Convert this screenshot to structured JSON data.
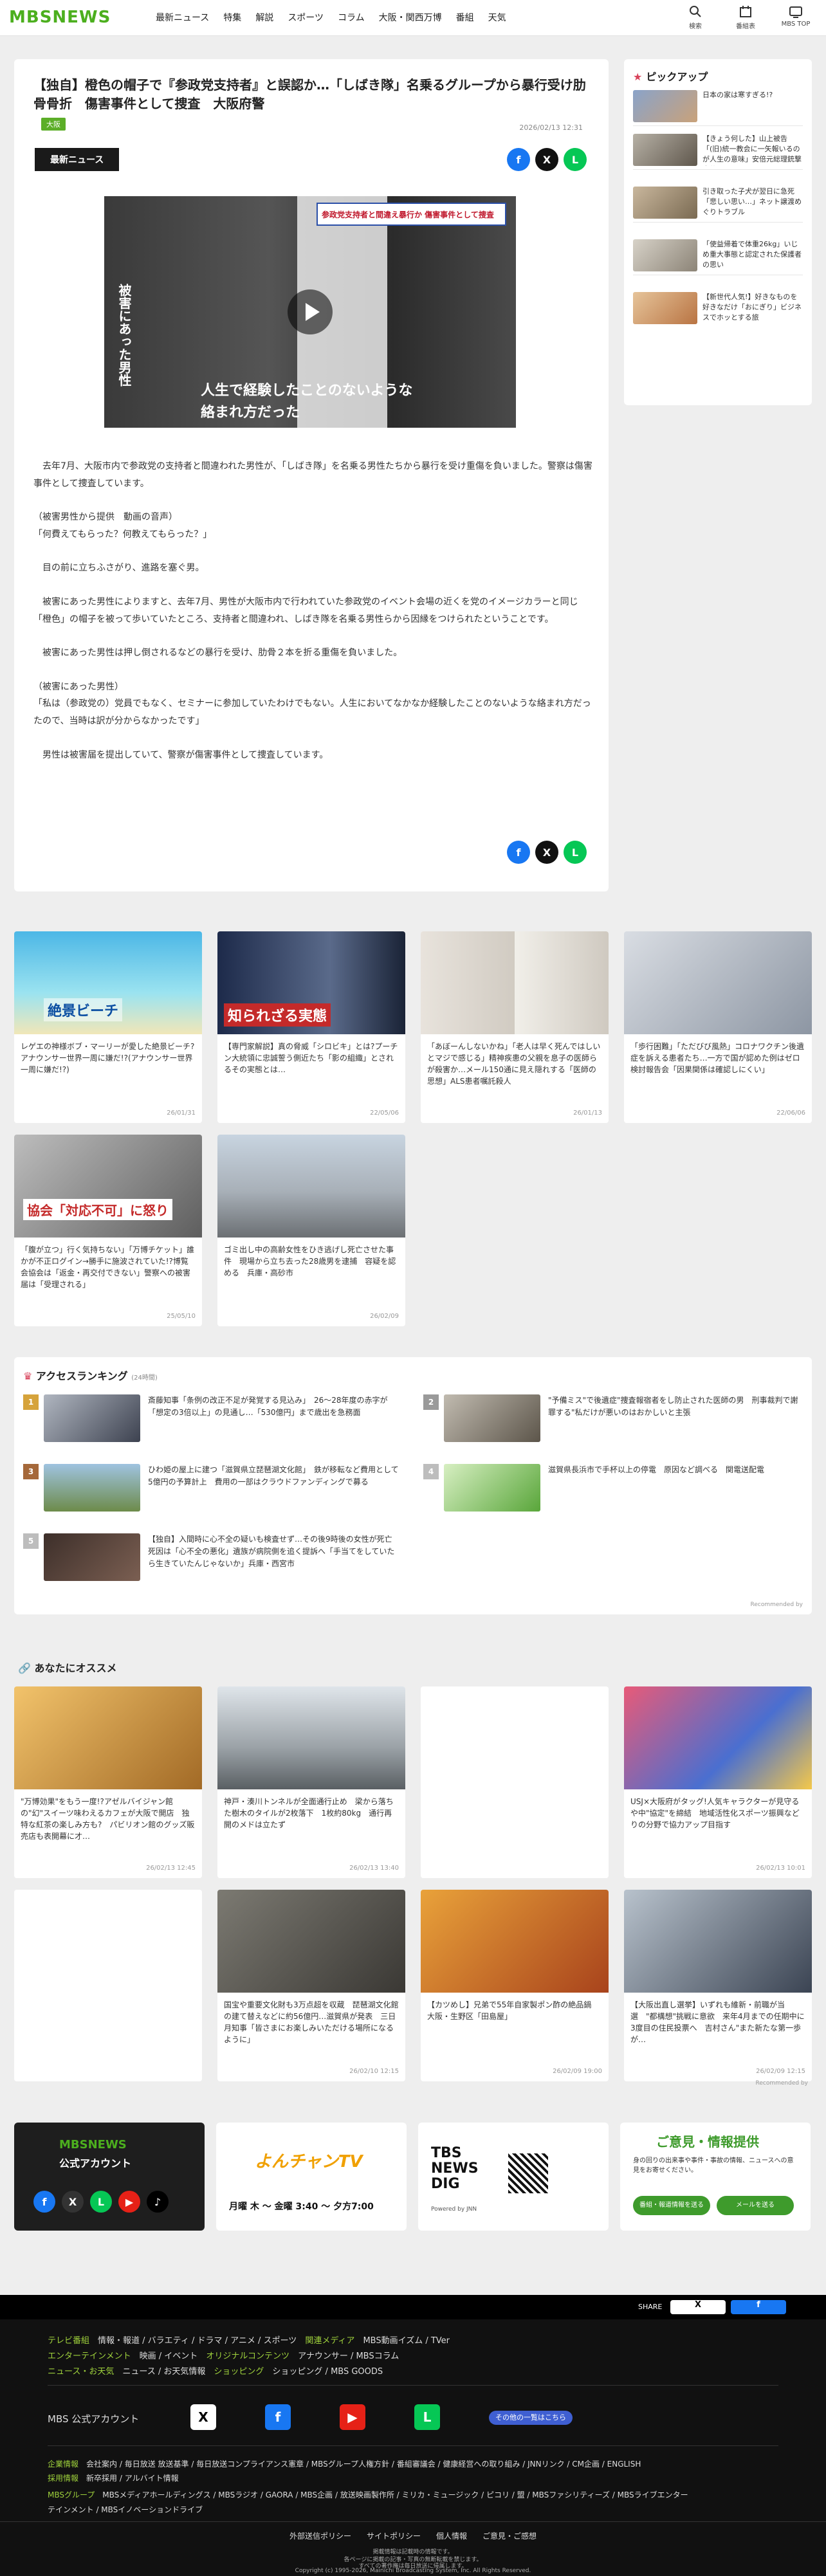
{
  "header": {
    "logo": "MBSNEWS",
    "nav": [
      "最新ニュース",
      "特集",
      "解説",
      "スポーツ",
      "コラム",
      "大阪・関西万博",
      "番組",
      "天気"
    ],
    "icons": [
      {
        "label": "検索",
        "icon": "search-icon"
      },
      {
        "label": "番組表",
        "icon": "calendar-icon"
      },
      {
        "label": "MBS TOP",
        "icon": "tv-icon"
      }
    ]
  },
  "article": {
    "title": "【独自】橙色の帽子で『参政党支持者』と誤認か…「しばき隊」名乗るグループから暴行受け肋骨骨折　傷害事件として捜査　大阪府警",
    "tag": "大阪",
    "date": "2026/02/13 12:31",
    "category": "最新ニュース",
    "video": {
      "top_caption": "参政党支持者と間違え暴行か 傷害事件として捜査",
      "side_caption": "被害にあった男性",
      "subtitle_line1": "人生で経験したことのないような",
      "subtitle_line2": "絡まれ方だった"
    },
    "paragraphs": [
      "　去年7月、大阪市内で参政党の支持者と間違われた男性が、「しばき隊」を名乗る男性たちから暴行を受け重傷を負いました。警察は傷害事件として捜査しています。",
      "（被害男性から提供　動画の音声）\n「何費えてもらった？何教えてもらった？」",
      "　目の前に立ちふさがり、進路を塞ぐ男。",
      "　被害にあった男性によりますと、去年7月、男性が大阪市内で行われていた参政党のイベント会場の近くを党のイメージカラーと同じ「橙色」の帽子を被って歩いていたところ、支持者と間違われ、しばき隊を名乗る男性らから因縁をつけられたということです。",
      "　被害にあった男性は押し倒されるなどの暴行を受け、肋骨２本を折る重傷を負いました。",
      "（被害にあった男性）\n「私は（参政党の）党員でもなく、セミナーに参加していたわけでもない。人生においてなかなか経験したことのないような絡まれ方だったので、当時は訳が分からなかったです」",
      "　男性は被害届を提出していて、警察が傷害事件として捜査しています。"
    ]
  },
  "pickup": {
    "title": "ピックアップ",
    "items": [
      "日本の家は寒すぎる!?",
      "【きょう何した】山上被告「(旧)統一教会に一矢報いるのが人生の意味」安倍元総理銃撃事件",
      "引き取った子犬が翌日に急死「悲しい思い…」ネット譲渡めぐりトラブル",
      "「使益帰着で体重26kg」いじめ重大事態と認定された保護者の思い",
      "【新世代人気!】好きなものを好きなだけ「おにぎり」ビジネスでホッとする旅"
    ]
  },
  "related": [
    {
      "text": "レゲエの神様ボブ・マーリーが愛した絶景ビーチ?アナウンサー世界一周に嫌だ!?(アナウンサー世界一周に嫌だ!?)",
      "date": "26/01/31",
      "label": "絶景ビーチ"
    },
    {
      "text": "【専門家解説】真の脅威「シロビキ」とは?プーチン大統領に忠誠誓う側近たち「影の組織」とされるその実態とは…",
      "date": "22/05/06",
      "label": "知られざる実態"
    },
    {
      "text": "「あぼーんしないかね」「老人は早く死んではしいとマジで感じる」精神疾患の父親を息子の医師らが殺害か…メール150通に見え隠れする「医師の思想」ALS患者嘱託殺人",
      "date": "26/01/13",
      "label": ""
    },
    {
      "text": "「歩行困難」「ただびび風熱」コロナワクチン後遺症を訴える患者たち…一方で国が認めた例はゼロ　検討報告会「因果関係は確認しにくい」",
      "date": "22/06/06",
      "label": ""
    },
    {
      "text": "「腹が立つ」行く気持ちない」「万博チケット」誰かが不正ログイン→勝手に施波されていた!?博覧会協会は「返金・再交付できない」警察への被害届は「受理される」",
      "date": "25/05/10",
      "label": "協会「対応不可」に怒り"
    },
    {
      "text": "ゴミ出し中の高齢女性をひき逃げし死亡させた事件　現場から立ち去った28歳男を逮捕　容疑を認める　兵庫・高砂市",
      "date": "26/02/09",
      "label": ""
    }
  ],
  "ranking": {
    "title": "アクセスランキング",
    "period": "(24時間)",
    "items": [
      {
        "rank": "1",
        "text": "斎藤知事「条例の改正不足が発覚する見込み」　26〜28年度の赤字が「想定の3倍以上」の見通し…「530億円」まで歳出を急務面"
      },
      {
        "rank": "2",
        "text": "\"予備ミス\"で後遺症\"捜査報宿者をし防止された医師の男　刑事裁判で謝罪する\"私だけが悪いのはおかしいと主張"
      },
      {
        "rank": "3",
        "text": "ひわ姫の屋上に建つ「滋賀県立琵琶湖文化館」　鉄が移転など費用として5億円の予算計上　費用の一部はクラウドファンディングで募る"
      },
      {
        "rank": "4",
        "text": "滋賀県長浜市で手杯以上の停電　原因など調べる　関電送配電"
      },
      {
        "rank": "5",
        "text": "【独自】入間時に心不全の疑いも検査せず…その後9時後の女性が死亡　死因は「心不全の悪化」遺族が病院側を追く提訴へ「手当てをしていたら生きていたんじゃないか」兵庫・西宮市"
      }
    ],
    "note": "Recommended by"
  },
  "recommend": {
    "title": "あなたにオススメ",
    "items": [
      {
        "text": "\"万博効果\"をもう一度!?アゼルバイジャン館の\"幻\"スイーツ味わえるカフェが大阪で開店　独特な紅茶の楽しみ方も?　パビリオン館のグッズ販売店も表開幕に才…",
        "date": "26/02/13 12:45"
      },
      {
        "text": "神戸・湊川トンネルが全面通行止め　梁から落ちた樹木のタイルが2枚落下　1枚約80kg　通行再開のメドは立たず",
        "date": "26/02/13 13:40"
      },
      {
        "text": "",
        "date": ""
      },
      {
        "text": "USJ×大阪府がタッグ!人気キャラクターが見守るや中\"協定\"を締結　地域活性化スポーツ振興などりの分野で協力アップ目指す",
        "date": "26/02/13 10:01"
      },
      {
        "text": "",
        "date": ""
      },
      {
        "text": "国宝や重要文化財も3万点超を収蔵　琵琶湖文化館の建て替えなどに約56億円…滋賀県が発表　三日月知事「皆さまにお楽しみいただける場所になるように」",
        "date": "26/02/10 12:15"
      },
      {
        "text": "【カツめし】兄弟で55年自家製ポン酢の絶品鍋　大阪・生野区「田島屋」",
        "date": "26/02/09 19:00"
      },
      {
        "text": "【大阪出直し選挙】いずれも維新・前職が当選　\"都構想\"挑戦に意欲　来年4月までの任期中に3度目の住民投票へ　吉村さん\"また新たな第一歩が…",
        "date": "26/02/09 12:15"
      }
    ],
    "note": "Recommended by"
  },
  "banners": {
    "official_title": "MBSNEWS",
    "official_sub": "公式アカウント",
    "yonchan": "よんチャンTV",
    "yonchan_time": "月曜 木 ～ 金曜 3:40 ～ 夕方7:00",
    "tbs": "TBS NEWS DIG",
    "tbs_sub": "Powered by JNN",
    "feedback_title": "ご意見・情報提供",
    "feedback_text": "身の回りの出来事や事件・事故の情報、ニュースへの意見をお寄せください。",
    "feedback_btn1": "番組・報道情報を送る",
    "feedback_btn2": "メールを送る"
  },
  "footer": {
    "share_label": "SHARE",
    "row1_label": "テレビ番組",
    "row1": "情報・報道 / バラエティ / ドラマ / アニメ / スポーツ",
    "row1b_label": "関連メディア",
    "row1b": "MBS動画イズム / TVer",
    "row2_label": "エンターテインメント",
    "row2": "映画 / イベント",
    "row2b_label": "オリジナルコンテンツ",
    "row2b": "アナウンサー / MBSコラム",
    "row3_label": "ニュース・お天気",
    "row3": "ニュース / お天気情報",
    "row3b_label": "ショッピング",
    "row3b": "ショッピング / MBS GOODS",
    "official": "MBS 公式アカウント",
    "others": "その他の一覧はこちら",
    "corp_label": "企業情報",
    "corp": "会社案内 / 毎日放送 放送基準 / 毎日放送コンプライアンス憲章 / MBSグループ人権方針 / 番組審議会 / 健康経営への取り組み / JNNリンク / CM企画 / ENGLISH",
    "recruit_label": "採用情報",
    "recruit": "新卒採用 / アルバイト情報",
    "group_label": "MBSグループ",
    "group": "MBSメディアホールディングス / MBSラジオ / GAORA / MBS企画 / 放送映画製作所 / ミリカ・ミュージック / ピコリ / 盟 / MBSファシリティーズ / MBSライブエンターテインメント / MBSイノベーションドライブ",
    "policy": "外部送信ポリシー　　サイトポリシー　　個人情報　　ご意見・ご感想",
    "c1": "掲載情報は記載時の情報です。",
    "c2": "各ページに掲載の記事・写真の無断転載を禁じます。",
    "c3": "すべての著作権は毎日放送に帰属します。",
    "copyright": "Copyright (c) 1995-2026, Mainichi Broadcasting System, Inc. All Rights Reserved."
  },
  "colors": {
    "brand": "#4caf1e",
    "accent": "#d8425a",
    "footer_bg": "#111111"
  }
}
